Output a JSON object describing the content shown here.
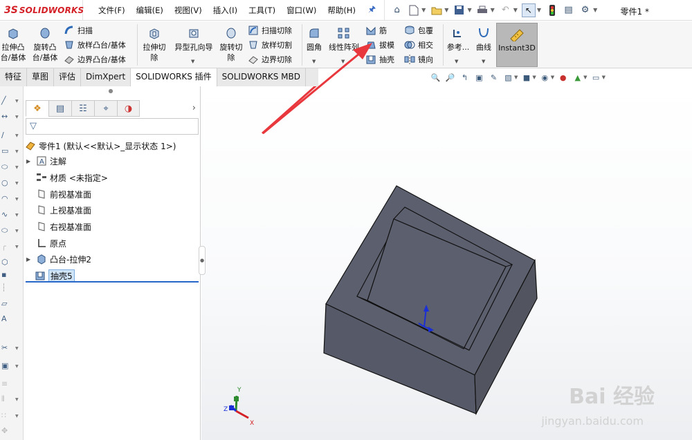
{
  "app": {
    "logo_text": "SOLIDWORKS",
    "logo_mark": "3S",
    "document_title": "零件1 *"
  },
  "menu": [
    "文件(F)",
    "编辑(E)",
    "视图(V)",
    "插入(I)",
    "工具(T)",
    "窗口(W)",
    "帮助(H)"
  ],
  "command_manager": {
    "features": {
      "extrude_boss": "拉伸凸台/基体",
      "revolve_boss": "旋转凸台/基体",
      "sweep": "扫描",
      "loft_boss": "放样凸台/基体",
      "boundary_boss": "边界凸台/基体",
      "extrude_cut": "拉伸切除",
      "hole_wizard": "异型孔向导",
      "revolve_cut": "旋转切除",
      "swept_cut": "扫描切除",
      "lofted_cut": "放样切割",
      "boundary_cut": "边界切除",
      "fillet": "圆角",
      "linear_pattern": "线性阵列",
      "rib": "筋",
      "draft": "拔模",
      "shell": "抽壳",
      "wrap": "包覆",
      "intersect": "相交",
      "mirror": "镜向",
      "reference": "参考...",
      "curves": "曲线",
      "instant3d": "Instant3D"
    }
  },
  "tabs": [
    "特征",
    "草图",
    "评估",
    "DimXpert",
    "SOLIDWORKS 插件",
    "SOLIDWORKS MBD"
  ],
  "feature_tree": {
    "root": "零件1 (默认<<默认>_显示状态 1>)",
    "items": [
      {
        "label": "注解",
        "expandable": true
      },
      {
        "label": "材质 <未指定>",
        "expandable": false
      },
      {
        "label": "前视基准面",
        "expandable": false
      },
      {
        "label": "上视基准面",
        "expandable": false
      },
      {
        "label": "右视基准面",
        "expandable": false
      },
      {
        "label": "原点",
        "expandable": false
      },
      {
        "label": "凸台-拉伸2",
        "expandable": true
      },
      {
        "label": "抽壳5",
        "expandable": false
      }
    ]
  },
  "triad": {
    "x": "X",
    "y": "Y",
    "z": "Z"
  },
  "watermark": {
    "main": "Bai 经验",
    "sub": "jingyan.baidu.com"
  },
  "colors": {
    "brand": "#d42027",
    "part_face": "#5c5f6e",
    "selection": "#cfe3f7",
    "arrow": "#e8383d"
  }
}
